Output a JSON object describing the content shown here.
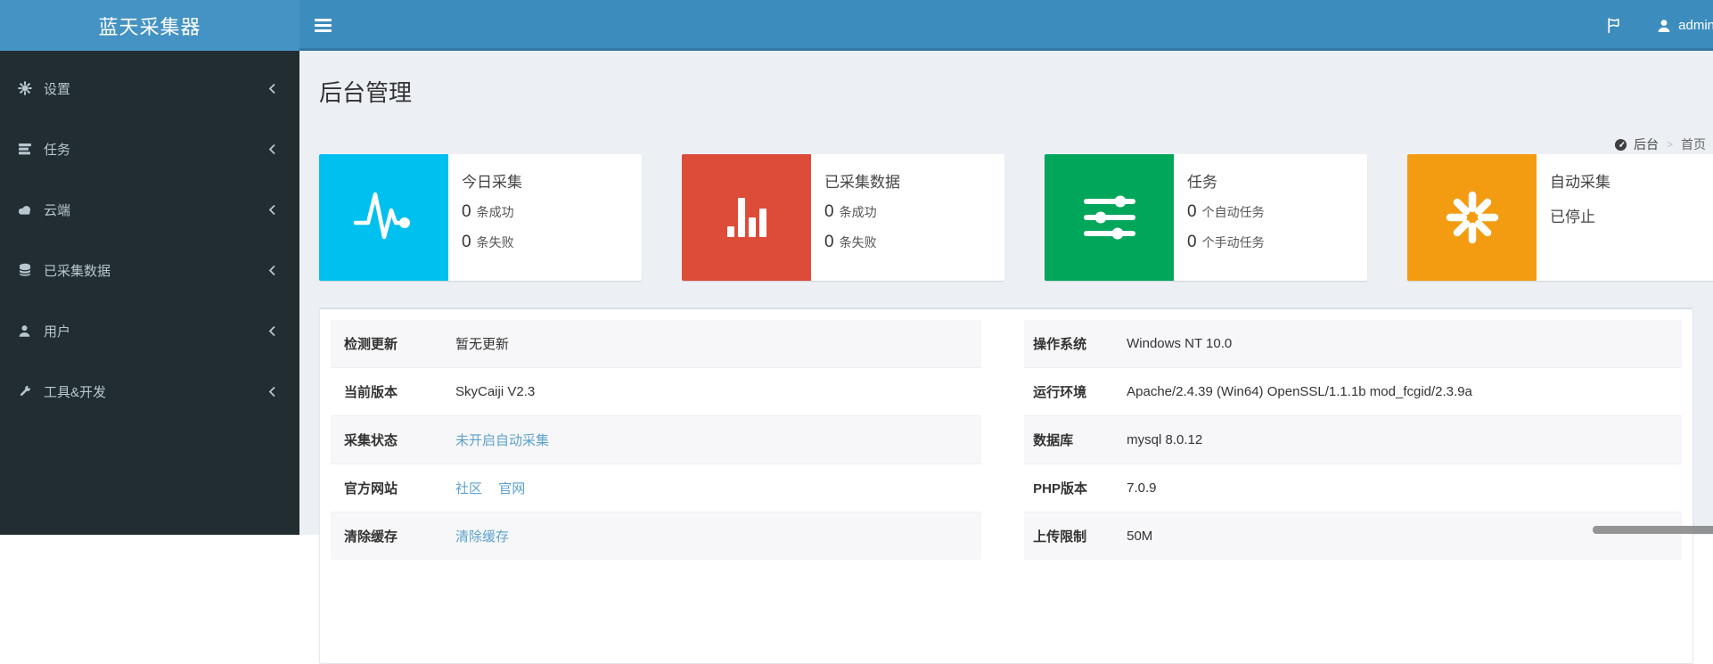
{
  "app": {
    "logo": "蓝天采集器"
  },
  "colors": {
    "navbar": "#3d8cbe",
    "logo_bg": "#4493c4",
    "sidebar": "#222d32",
    "aqua": "#00c0ef",
    "red": "#dd4b39",
    "green": "#00a65a",
    "yellow": "#f39c12",
    "link": "#5da2ce",
    "page_bg": "#ecf0f5"
  },
  "navbar": {
    "user": "admin"
  },
  "sidebar": {
    "items": [
      {
        "label": "设置",
        "icon": "gear-icon"
      },
      {
        "label": "任务",
        "icon": "tasks-icon"
      },
      {
        "label": "云端",
        "icon": "cloud-icon"
      },
      {
        "label": "已采集数据",
        "icon": "database-icon"
      },
      {
        "label": "用户",
        "icon": "user-icon"
      },
      {
        "label": "工具&开发",
        "icon": "wrench-icon"
      }
    ]
  },
  "page": {
    "title": "后台管理",
    "breadcrumb": {
      "root": "后台",
      "separator": ">",
      "current": "首页"
    }
  },
  "info_boxes": [
    {
      "title": "今日采集",
      "line1_num": "0",
      "line1_text": "条成功",
      "line2_num": "0",
      "line2_text": "条失败",
      "color": "#00c0ef",
      "icon": "pulse-icon"
    },
    {
      "title": "已采集数据",
      "line1_num": "0",
      "line1_text": "条成功",
      "line2_num": "0",
      "line2_text": "条失败",
      "color": "#dd4b39",
      "icon": "bar-chart-icon"
    },
    {
      "title": "任务",
      "line1_num": "0",
      "line1_text": "个自动任务",
      "line2_num": "0",
      "line2_text": "个手动任务",
      "color": "#00a65a",
      "icon": "sliders-icon"
    },
    {
      "title": "自动采集",
      "status": "已停止",
      "color": "#f39c12",
      "icon": "asterisk-icon"
    }
  ],
  "status_table": {
    "rows": [
      {
        "label": "检测更新",
        "value": "暂无更新"
      },
      {
        "label": "当前版本",
        "value": "SkyCaiji V2.3"
      },
      {
        "label": "采集状态",
        "value": "未开启自动采集"
      },
      {
        "label": "官方网站",
        "links": [
          "社区",
          "官网"
        ]
      },
      {
        "label": "清除缓存",
        "value": "清除缓存"
      }
    ]
  },
  "env_table": {
    "rows": [
      {
        "label": "操作系统",
        "value": "Windows NT 10.0"
      },
      {
        "label": "运行环境",
        "value": "Apache/2.4.39 (Win64) OpenSSL/1.1.1b mod_fcgid/2.3.9a"
      },
      {
        "label": "数据库",
        "value": "mysql 8.0.12"
      },
      {
        "label": "PHP版本",
        "value": "7.0.9"
      },
      {
        "label": "上传限制",
        "value": "50M"
      }
    ]
  }
}
